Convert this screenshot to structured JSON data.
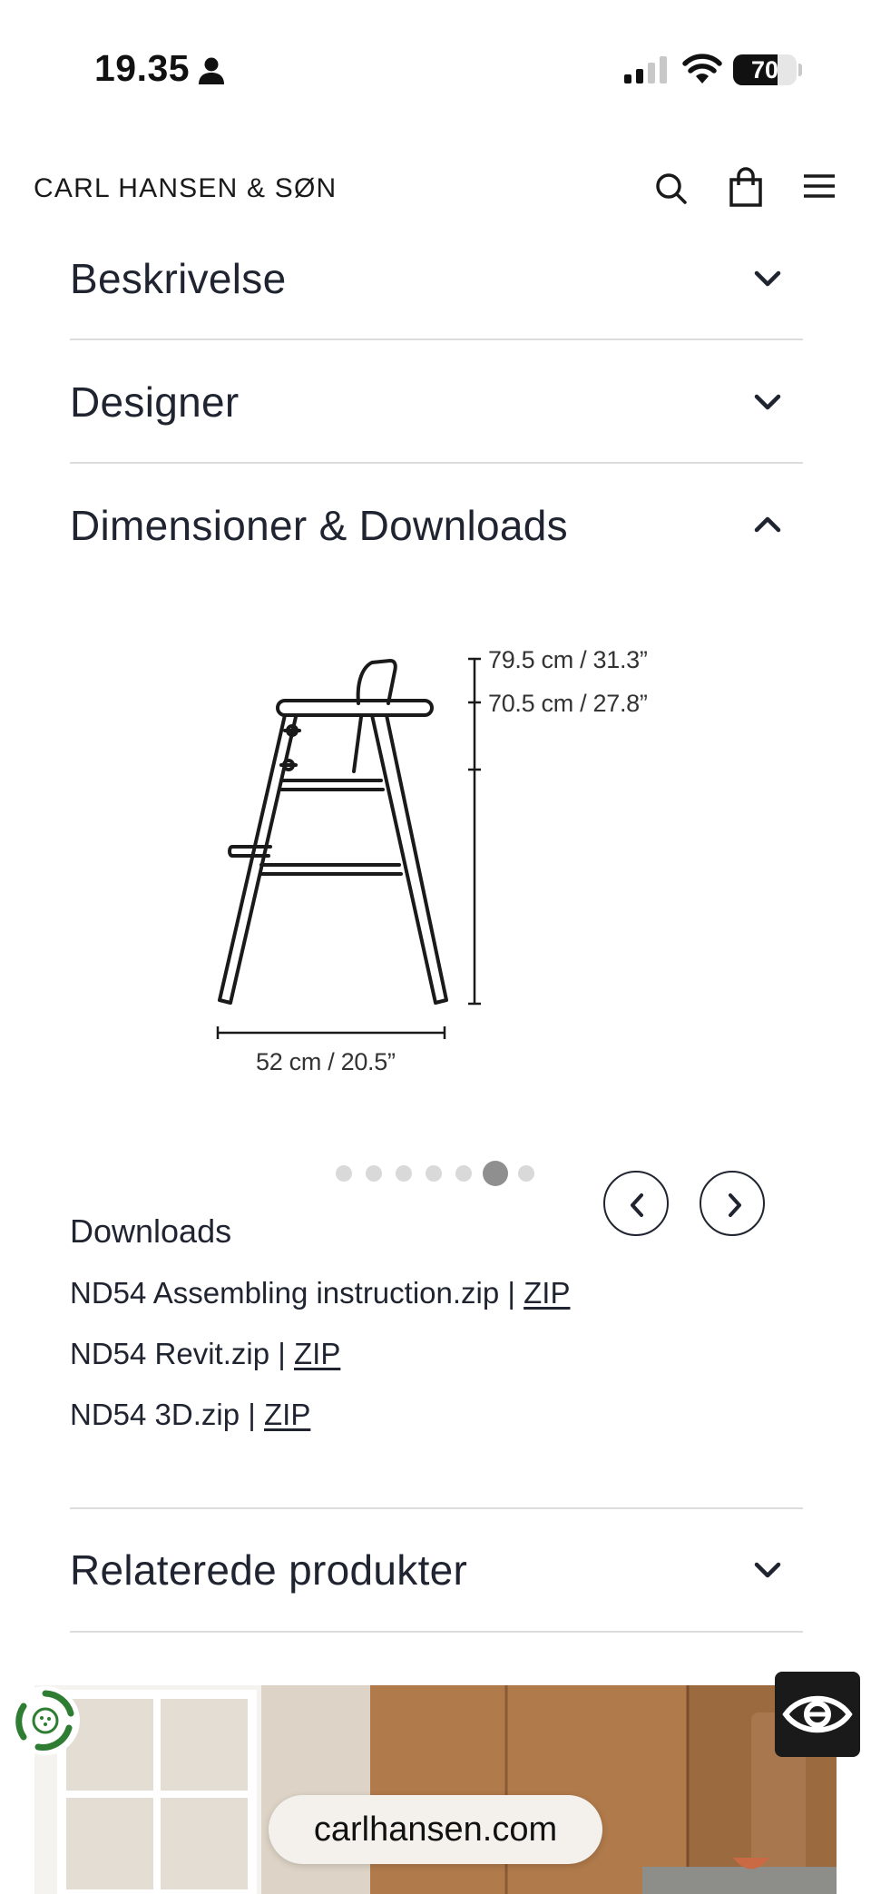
{
  "status_bar": {
    "time": "19.35",
    "battery": "70"
  },
  "header": {
    "brand": "CARL HANSEN & SØN"
  },
  "accordion": [
    {
      "title": "Beskrivelse",
      "state": "collapsed"
    },
    {
      "title": "Designer",
      "state": "collapsed"
    },
    {
      "title": "Dimensioner & Downloads",
      "state": "expanded"
    },
    {
      "title": "Relaterede produkter",
      "state": "collapsed"
    }
  ],
  "dimensions": {
    "height_total": "79.5 cm / 31.3”",
    "height_seat": "70.5 cm / 27.8”",
    "width": "52 cm / 20.5”"
  },
  "carousel": {
    "total": 7,
    "active_index": 5
  },
  "downloads": {
    "title": "Downloads",
    "separator": " | ",
    "items": [
      {
        "name": "ND54 Assembling instruction.zip",
        "link": "ZIP"
      },
      {
        "name": "ND54 Revit.zip",
        "link": "ZIP"
      },
      {
        "name": "ND54 3D.zip",
        "link": "ZIP"
      }
    ]
  },
  "footer_banner": {
    "url": "carlhansen.com"
  },
  "colors": {
    "text": "#1f2430",
    "divider": "#dcdcdc",
    "dot": "#d9d9d9",
    "dot_active": "#8f8f8f"
  }
}
